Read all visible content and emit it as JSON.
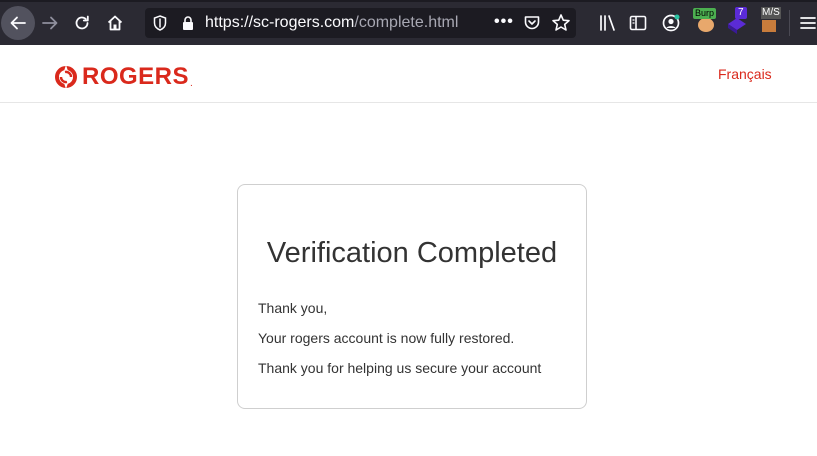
{
  "browser": {
    "url_host": "https://sc-rogers.com",
    "url_path": "/complete.html",
    "url_actions": "•••",
    "extensions": {
      "burp_label": "Burp",
      "ublock_count": "7",
      "ms_label": "M/S"
    },
    "icons": [
      "back-arrow-icon",
      "forward-arrow-icon",
      "reload-icon",
      "home-icon",
      "tracking-shield-icon",
      "lock-icon",
      "page-actions-icon",
      "pocket-icon",
      "bookmark-star-icon",
      "library-icon",
      "sidebar-icon",
      "account-icon",
      "hamburger-menu-icon"
    ]
  },
  "header": {
    "logo_text": "ROGERS",
    "logo_dot": ".",
    "language_link": "Français",
    "brand_color": "#da291c"
  },
  "card": {
    "title": "Verification Completed",
    "lines": [
      "Thank you,",
      "Your rogers account is now fully restored.",
      "Thank you for helping us secure your account"
    ]
  }
}
